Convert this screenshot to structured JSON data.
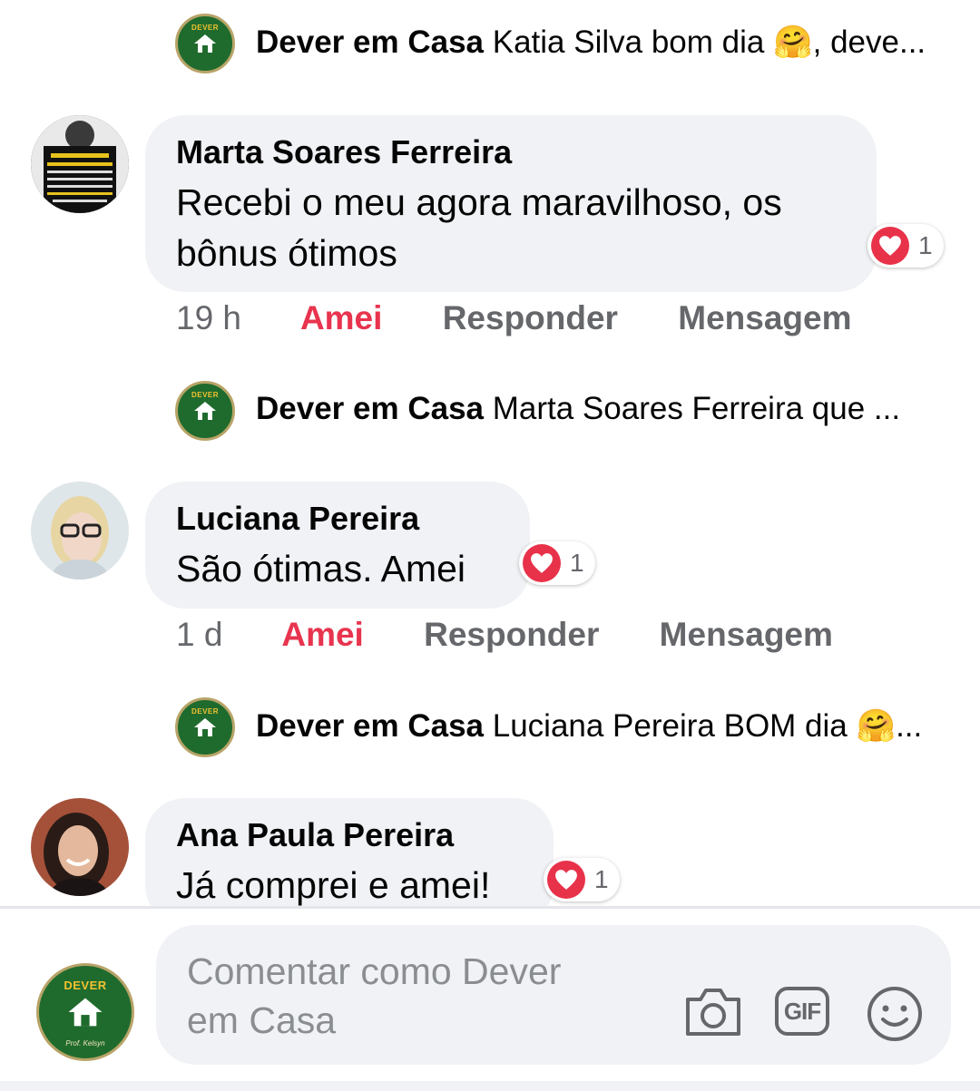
{
  "page_name": "Dever em Casa",
  "logo": {
    "top": "DEVER",
    "bottom": "Prof. Kelsyn"
  },
  "thread": [
    {
      "type": "reply",
      "page": "Dever em Casa",
      "text": "Katia Silva bom dia 🤗, deve..."
    },
    {
      "type": "comment",
      "author": "Marta Soares Ferreira",
      "text_lines": [
        "Recebi o meu agora maravilhoso, os",
        "bônus ótimos"
      ],
      "reaction": {
        "icon": "heart-icon",
        "count": "1"
      },
      "time": "19 h",
      "reaction_label": "Amei",
      "reply_label": "Responder",
      "message_label": "Mensagem"
    },
    {
      "type": "reply",
      "page": "Dever em Casa",
      "text": "Marta Soares Ferreira que ..."
    },
    {
      "type": "comment",
      "author": "Luciana Pereira",
      "text_lines": [
        "São ótimas. Amei"
      ],
      "reaction": {
        "icon": "heart-icon",
        "count": "1"
      },
      "time": "1 d",
      "reaction_label": "Amei",
      "reply_label": "Responder",
      "message_label": "Mensagem"
    },
    {
      "type": "reply",
      "page": "Dever em Casa",
      "text": "Luciana Pereira  BOM dia 🤗..."
    },
    {
      "type": "comment",
      "author": "Ana Paula Pereira",
      "text_lines": [
        "Já comprei e amei!"
      ],
      "reaction": {
        "icon": "heart-icon",
        "count": "1"
      }
    }
  ],
  "composer": {
    "placeholder": "Comentar como Dever em Casa",
    "icons": [
      "camera-icon",
      "gif-icon",
      "emoji-icon"
    ],
    "gif_label": "GIF"
  },
  "colors": {
    "accent_love": "#e8344e",
    "bubble": "#f0f2f5",
    "muted": "#65676b",
    "logo_green": "#1f6b2d"
  }
}
